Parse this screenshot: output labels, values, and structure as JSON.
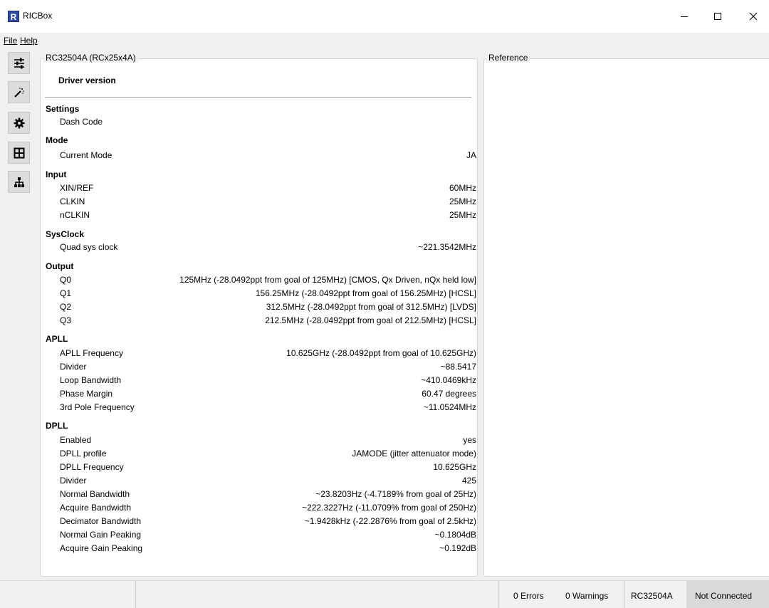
{
  "window": {
    "title": "RICBox",
    "app_icon_letter": "R"
  },
  "menu": {
    "file": "File",
    "help": "Help"
  },
  "toolbar": {
    "buttons": [
      "sliders-icon",
      "magic-wand-icon",
      "gear-icon",
      "grid-icon",
      "hierarchy-icon"
    ]
  },
  "left_panel": {
    "caption": "RC32504A (RCx25x4A)",
    "driver_title": "Driver version",
    "sections": [
      {
        "title": "Settings",
        "rows": [
          {
            "label": "Dash Code",
            "value": ""
          }
        ]
      },
      {
        "title": "Mode",
        "rows": [
          {
            "label": "Current Mode",
            "value": "JA"
          }
        ]
      },
      {
        "title": "Input",
        "rows": [
          {
            "label": "XIN/REF",
            "value": "60MHz"
          },
          {
            "label": "CLKIN",
            "value": "25MHz"
          },
          {
            "label": "nCLKIN",
            "value": "25MHz"
          }
        ]
      },
      {
        "title": "SysClock",
        "rows": [
          {
            "label": "Quad sys clock",
            "value": "~221.3542MHz"
          }
        ]
      },
      {
        "title": "Output",
        "rows": [
          {
            "label": "Q0",
            "value": "125MHz (-28.0492ppt from goal of 125MHz) [CMOS, Qx Driven, nQx held low]"
          },
          {
            "label": "Q1",
            "value": "156.25MHz (-28.0492ppt from goal of 156.25MHz) [HCSL]"
          },
          {
            "label": "Q2",
            "value": "312.5MHz (-28.0492ppt from goal of 312.5MHz) [LVDS]"
          },
          {
            "label": "Q3",
            "value": "212.5MHz (-28.0492ppt from goal of 212.5MHz) [HCSL]"
          }
        ]
      },
      {
        "title": "APLL",
        "rows": [
          {
            "label": "APLL Frequency",
            "value": "10.625GHz (-28.0492ppt from goal of 10.625GHz)"
          },
          {
            "label": "Divider",
            "value": "~88.5417"
          },
          {
            "label": "Loop Bandwidth",
            "value": "~410.0469kHz"
          },
          {
            "label": "Phase Margin",
            "value": "60.47 degrees"
          },
          {
            "label": "3rd Pole Frequency",
            "value": "~11.0524MHz"
          }
        ]
      },
      {
        "title": "DPLL",
        "rows": [
          {
            "label": "Enabled",
            "value": "yes"
          },
          {
            "label": "DPLL profile",
            "value": "JAMODE (jitter attenuator mode)"
          },
          {
            "label": "DPLL Frequency",
            "value": "10.625GHz"
          },
          {
            "label": "Divider",
            "value": "425"
          },
          {
            "label": "Normal Bandwidth",
            "value": "~23.8203Hz (-4.7189% from goal of 25Hz)"
          },
          {
            "label": "Acquire Bandwidth",
            "value": "~222.3227Hz (-11.0709% from goal of 250Hz)"
          },
          {
            "label": "Decimator Bandwidth",
            "value": "~1.9428kHz (-22.2876% from goal of 2.5kHz)"
          },
          {
            "label": "Normal Gain Peaking",
            "value": "~0.1804dB"
          },
          {
            "label": "Acquire Gain Peaking",
            "value": "~0.192dB"
          }
        ]
      }
    ]
  },
  "right_panel": {
    "caption": "Reference"
  },
  "status": {
    "errors": "0 Errors",
    "warnings": "0 Warnings",
    "device": "RC32504A",
    "connection": "Not Connected"
  }
}
